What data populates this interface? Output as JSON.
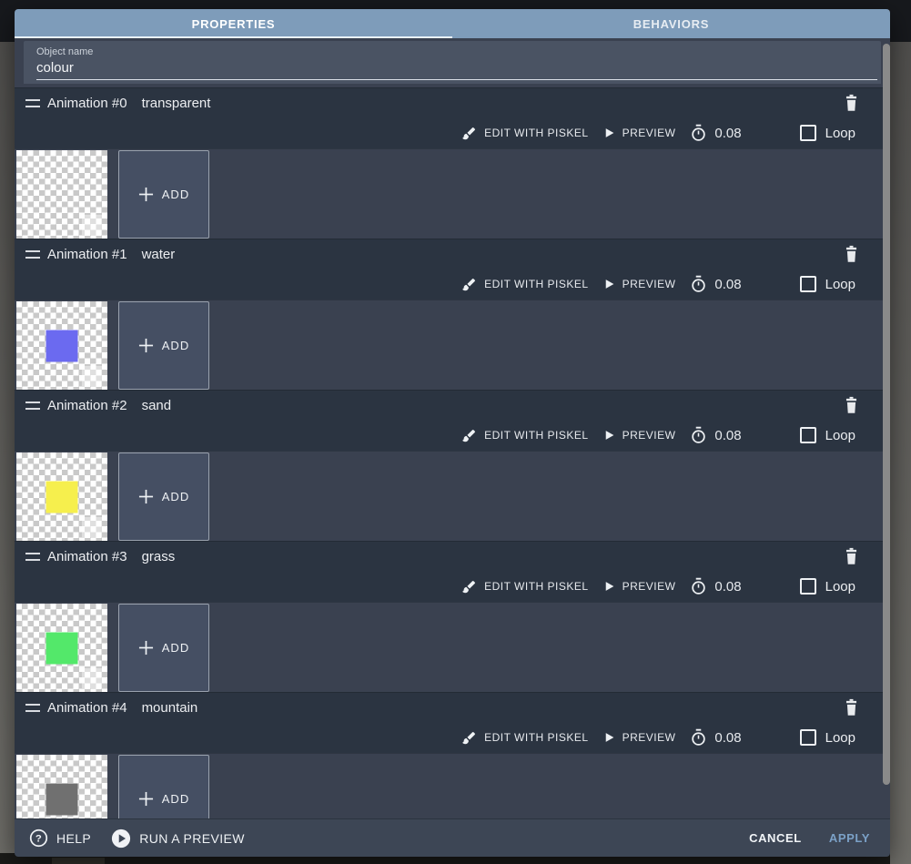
{
  "dialog": {
    "tabs": [
      {
        "label": "PROPERTIES",
        "active": true
      },
      {
        "label": "BEHAVIORS",
        "active": false
      }
    ],
    "object_name": {
      "label": "Object name",
      "value": "colour"
    },
    "controls": {
      "edit_label": "EDIT WITH PISKEL",
      "preview_label": "PREVIEW",
      "loop_label": "Loop",
      "add_label": "ADD",
      "loop_checked": false
    },
    "animations": [
      {
        "title": "Animation #0",
        "name": "transparent",
        "time": "0.08",
        "frame_color": null
      },
      {
        "title": "Animation #1",
        "name": "water",
        "time": "0.08",
        "frame_color": "#6b6af0"
      },
      {
        "title": "Animation #2",
        "name": "sand",
        "time": "0.08",
        "frame_color": "#f6ef4d"
      },
      {
        "title": "Animation #3",
        "name": "grass",
        "time": "0.08",
        "frame_color": "#53e86a"
      },
      {
        "title": "Animation #4",
        "name": "mountain",
        "time": "0.08",
        "frame_color": "#707070"
      }
    ],
    "footer": {
      "help_label": "HELP",
      "run_label": "RUN A PREVIEW",
      "cancel_label": "CANCEL",
      "apply_label": "APPLY"
    }
  },
  "icons": {
    "drag": "drag-handle-icon",
    "edit": "brush-icon",
    "preview": "play-icon",
    "time": "stopwatch-icon",
    "delete": "trash-icon",
    "add": "plus-icon",
    "help": "help-circle-icon",
    "run": "play-circle-icon"
  },
  "colors": {
    "tabbar": "#7e9cba",
    "tab_indicator": "#e9f5fe",
    "header_band": "#2b3441",
    "frames_band": "#3a4150",
    "name_card": "#4a5363",
    "footer_bar": "#3d4655",
    "apply_accent": "#7ba1c7",
    "checker_light": "#ffffff",
    "checker_dark": "#c9c9c9",
    "water": "#6b6af0",
    "sand": "#f6ef4d",
    "grass": "#53e86a",
    "mountain": "#707070"
  }
}
